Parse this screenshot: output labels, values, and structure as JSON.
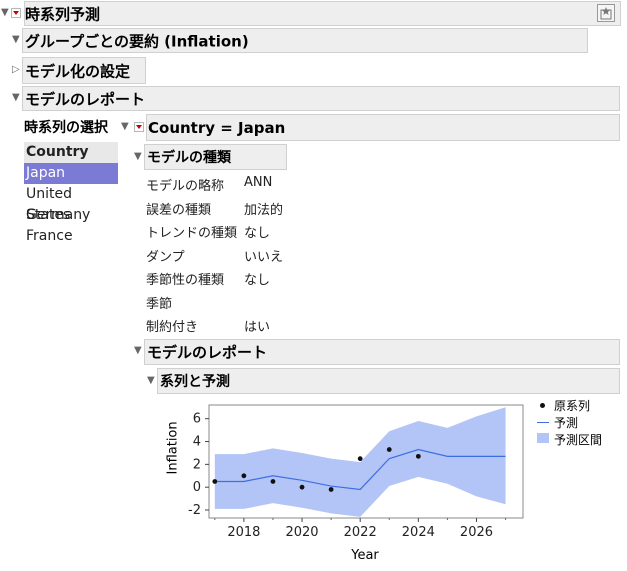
{
  "title": "時系列予測",
  "group_summary": "グループごとの要約 (Inflation)",
  "model_settings": "モデル化の設定",
  "model_report": "モデルのレポート",
  "series_select": {
    "label": "時系列の選択",
    "list_header": "Country",
    "items": [
      "Japan",
      "United States",
      "Germany",
      "France"
    ],
    "selected": "Japan"
  },
  "country_header": "Country = Japan",
  "model_type": {
    "header": "モデルの種類",
    "rows": [
      {
        "label": "モデルの略称",
        "value": "ANN"
      },
      {
        "label": "誤差の種類",
        "value": "加法的"
      },
      {
        "label": "トレンドの種類",
        "value": "なし"
      },
      {
        "label": "ダンプ",
        "value": "いいえ"
      },
      {
        "label": "季節性の種類",
        "value": "なし"
      },
      {
        "label": "季節",
        "value": ""
      },
      {
        "label": "制約付き",
        "value": "はい"
      }
    ]
  },
  "inner_report": "モデルのレポート",
  "series_forecast": "系列と予測",
  "legend": {
    "observed": "原系列",
    "forecast": "予測",
    "interval": "予測区間"
  },
  "colors": {
    "band": "#b3c4f7",
    "line": "#3e6fe0",
    "selected": "#7b7bd6"
  },
  "chart_data": {
    "type": "line",
    "xlabel": "Year",
    "ylabel": "Inflation",
    "xlim": [
      2016.8,
      2027.6
    ],
    "ylim": [
      -2.7,
      7.2
    ],
    "xticks": [
      2018,
      2020,
      2022,
      2024,
      2026
    ],
    "yticks": [
      -2,
      0,
      2,
      4,
      6
    ],
    "observed": [
      {
        "x": 2017,
        "y": 0.5
      },
      {
        "x": 2018,
        "y": 1.0
      },
      {
        "x": 2019,
        "y": 0.5
      },
      {
        "x": 2020,
        "y": 0.0
      },
      {
        "x": 2021,
        "y": -0.2
      },
      {
        "x": 2022,
        "y": 2.5
      },
      {
        "x": 2023,
        "y": 3.3
      },
      {
        "x": 2024,
        "y": 2.7
      }
    ],
    "forecast": [
      {
        "x": 2017,
        "y": 0.5
      },
      {
        "x": 2018,
        "y": 0.5
      },
      {
        "x": 2019,
        "y": 1.0
      },
      {
        "x": 2020,
        "y": 0.6
      },
      {
        "x": 2021,
        "y": 0.1
      },
      {
        "x": 2022,
        "y": -0.2
      },
      {
        "x": 2023,
        "y": 2.5
      },
      {
        "x": 2024,
        "y": 3.3
      },
      {
        "x": 2025,
        "y": 2.7
      },
      {
        "x": 2026,
        "y": 2.7
      },
      {
        "x": 2027,
        "y": 2.7
      }
    ],
    "interval": [
      {
        "x": 2017,
        "lo": -1.9,
        "hi": 2.9
      },
      {
        "x": 2018,
        "lo": -1.9,
        "hi": 2.9
      },
      {
        "x": 2019,
        "lo": -1.4,
        "hi": 3.4
      },
      {
        "x": 2020,
        "lo": -1.8,
        "hi": 3.0
      },
      {
        "x": 2021,
        "lo": -2.3,
        "hi": 2.5
      },
      {
        "x": 2022,
        "lo": -2.6,
        "hi": 2.2
      },
      {
        "x": 2023,
        "lo": 0.1,
        "hi": 4.9
      },
      {
        "x": 2024,
        "lo": 0.9,
        "hi": 5.8
      },
      {
        "x": 2025,
        "lo": 0.3,
        "hi": 5.2
      },
      {
        "x": 2026,
        "lo": -0.8,
        "hi": 6.2
      },
      {
        "x": 2027,
        "lo": -1.5,
        "hi": 7.0
      }
    ]
  }
}
